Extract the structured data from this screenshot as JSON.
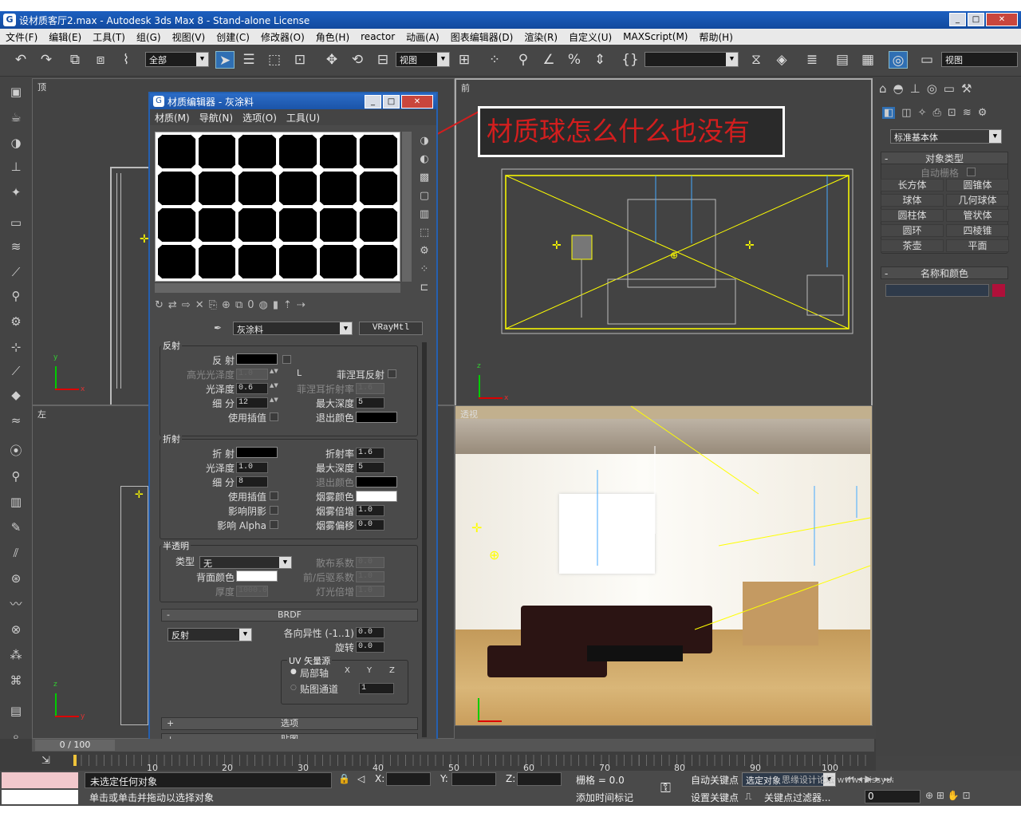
{
  "window": {
    "title": "设材质客厅2.max - Autodesk 3ds Max 8 - Stand-alone License"
  },
  "menu": [
    "文件(F)",
    "编辑(E)",
    "工具(T)",
    "组(G)",
    "视图(V)",
    "创建(C)",
    "修改器(O)",
    "角色(H)",
    "reactor",
    "动画(A)",
    "图表编辑器(D)",
    "渲染(R)",
    "自定义(U)",
    "MAXScript(M)",
    "帮助(H)"
  ],
  "toolbar": {
    "selection_filter": "全部",
    "ref_coord": "视图",
    "named_sel": "",
    "view_right": "视图"
  },
  "viewports": {
    "top": "顶",
    "front": "前",
    "left": "左",
    "persp": "透视"
  },
  "material_editor": {
    "title": "材质编辑器 - 灰涂料",
    "menu": [
      "材质(M)",
      "导航(N)",
      "选项(O)",
      "工具(U)"
    ],
    "material_name": "灰涂料",
    "material_type": "VRayMtl",
    "reflect": {
      "title": "反射",
      "reflect_label": "反  射",
      "hilight_gloss_label": "高光光泽度",
      "hilight_gloss": "1.0",
      "l_btn": "L",
      "fresnel_label": "菲涅耳反射",
      "gloss_label": "光泽度",
      "gloss": "0.6",
      "fresnel_ior_label": "菲涅耳折射率",
      "fresnel_ior": "1.6",
      "subdivs_label": "细  分",
      "subdivs": "12",
      "max_depth_label": "最大深度",
      "max_depth": "5",
      "use_interp_label": "使用插值",
      "exit_color_label": "退出颜色"
    },
    "refract": {
      "title": "折射",
      "refract_label": "折  射",
      "ior_label": "折射率",
      "ior": "1.6",
      "gloss_label": "光泽度",
      "gloss": "1.0",
      "max_depth_label": "最大深度",
      "max_depth": "5",
      "subdivs_label": "细  分",
      "subdivs": "8",
      "exit_color_label": "退出颜色",
      "use_interp_label": "使用插值",
      "fog_color_label": "烟雾颜色",
      "affect_shadows_label": "影响阴影",
      "fog_mult_label": "烟雾倍增",
      "fog_mult": "1.0",
      "affect_alpha_label": "影响 Alpha",
      "fog_bias_label": "烟雾偏移",
      "fog_bias": "0.0"
    },
    "translucency": {
      "title": "半透明",
      "type_label": "类型",
      "type": "无",
      "scatter_label": "散布系数",
      "scatter": "0.0",
      "back_color_label": "背面颜色",
      "fb_label": "前/后驱系数",
      "fb": "1.0",
      "thickness_label": "厚度",
      "thickness": "1000.0",
      "light_mult_label": "灯光倍增",
      "light_mult": "1.0"
    },
    "brdf": {
      "title": "BRDF",
      "minus": "-",
      "type": "反射",
      "aniso_label": "各向异性 (-1..1)",
      "aniso": "0.0",
      "rotation_label": "旋转",
      "rotation": "0.0",
      "uv_label": "UV 矢量源",
      "local_axis_label": "局部轴",
      "x": "X",
      "y": "Y",
      "z": "Z",
      "map_channel_label": "贴图通道",
      "map_channel": "1"
    },
    "options_label": "选项",
    "options_plus": "+",
    "maps_label": "贴图",
    "maps_plus": "+"
  },
  "annotation": "材质球怎么什么也没有",
  "command_panel": {
    "category": "标准基本体",
    "rollout_object_type": "对象类型",
    "rollout_minus": "-",
    "autogrid": "自动栅格",
    "buttons": [
      "长方体",
      "圆锥体",
      "球体",
      "几何球体",
      "圆柱体",
      "管状体",
      "圆环",
      "四棱锥",
      "茶壶",
      "平面"
    ],
    "rollout_name_color": "名称和颜色",
    "name": "",
    "color": "#b0103a"
  },
  "timeline": {
    "frame": "0 / 100",
    "ticks": [
      "10",
      "20",
      "30",
      "40",
      "50",
      "60",
      "70",
      "80",
      "90",
      "100"
    ]
  },
  "status": {
    "line1": "未选定任何对象",
    "line2": "单击或单击并拖动以选择对象",
    "x_label": "X:",
    "y_label": "Y:",
    "z_label": "Z:",
    "grid": "栅格 = 0.0",
    "add_time_tag": "添加时间标记",
    "auto_key": "自动关键点",
    "set_key": "设置关键点",
    "sel_set": "选定对象",
    "key_filters": "关键点过滤器...",
    "frame_value": "0",
    "watermark": "思缘设计论坛 www.missyuan.com"
  }
}
